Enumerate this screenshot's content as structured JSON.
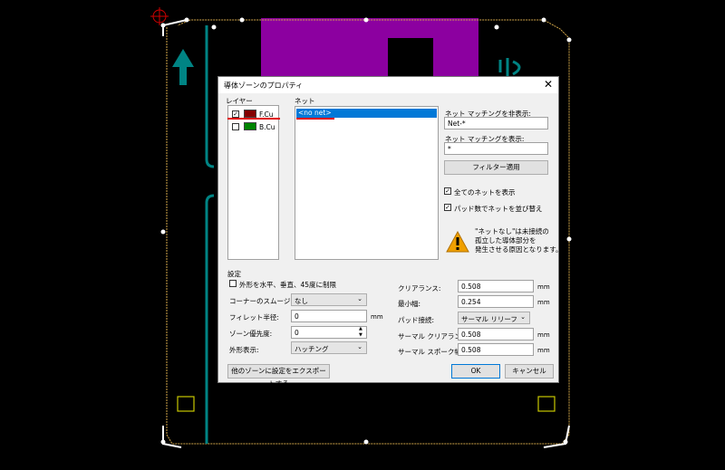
{
  "dialog": {
    "title": "導体ゾーンのプロパティ",
    "close_glyph": "✕"
  },
  "layers": {
    "heading": "レイヤー",
    "items": [
      {
        "label": "F.Cu",
        "checked": true,
        "color": "#840000",
        "check_glyph": "✓"
      },
      {
        "label": "B.Cu",
        "checked": false,
        "color": "#008400",
        "check_glyph": ""
      }
    ]
  },
  "nets": {
    "heading": "ネット",
    "selected": "<no net>",
    "hide_label": "ネット マッチングを非表示:",
    "hide_value": "Net-*",
    "show_label": "ネット マッチングを表示:",
    "show_value": "*",
    "filter_button": "フィルター適用",
    "show_all_label": "全てのネットを表示",
    "sort_label": "パッド数でネットを並び替え",
    "warning_text": "\"ネットなし\"は未接続の\n孤立した導体部分を\n発生させる原因となります。",
    "check_glyph": "✓"
  },
  "settings": {
    "heading": "設定",
    "constrain_label": "外形を水平、垂直、45度に制限",
    "corner_label": "コーナーのスムージング:",
    "corner_value": "なし",
    "fillet_label": "フィレット半径:",
    "fillet_value": "0",
    "priority_label": "ゾーン優先度:",
    "priority_value": "0",
    "outline_label": "外形表示:",
    "outline_value": "ハッチング",
    "clearance_label": "クリアランス:",
    "clearance_value": "0.508",
    "min_width_label": "最小幅:",
    "min_width_value": "0.254",
    "pad_conn_label": "パッド接続:",
    "pad_conn_value": "サーマル リリーフ",
    "thermal_clear_label": "サーマル クリアランス:",
    "thermal_clear_value": "0.508",
    "thermal_spoke_label": "サーマル スポーク幅:",
    "thermal_spoke_value": "0.508",
    "unit": "mm"
  },
  "footer": {
    "export_button": "他のゾーンに設定をエクスポートする",
    "ok_button": "OK",
    "cancel_button": "キャンセル"
  },
  "colors": {
    "board_outline": "#d4a84a",
    "track": "#008484",
    "copper_fill": "#8c00a0",
    "selection": "#0078d7",
    "annotation": "#e00000",
    "pad_outline": "#c8c800"
  }
}
